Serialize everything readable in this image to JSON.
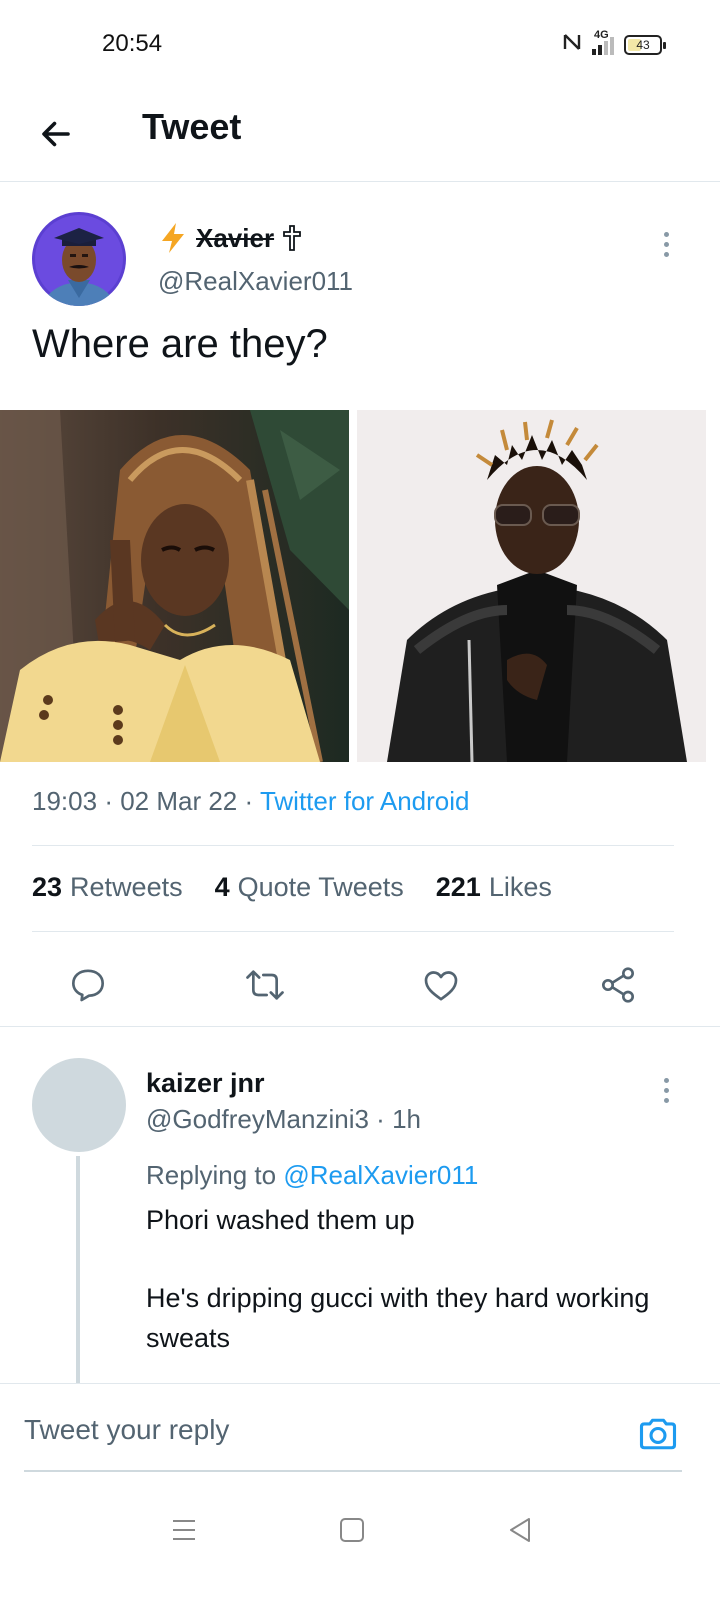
{
  "status_bar": {
    "time": "20:54",
    "network": "4G",
    "battery_level": "43",
    "battery_fraction": 0.43
  },
  "header": {
    "title": "Tweet",
    "back_icon": "arrow-left-icon"
  },
  "tweet": {
    "author_name": "Xavier",
    "author_handle": "@RealXavier011",
    "name_prefix_icon": "lightning-bolt-icon",
    "name_suffix_icon": "cross-icon",
    "text": "Where are they?",
    "time": "19:03",
    "date": "02 Mar 22",
    "source": "Twitter for Android",
    "stats": {
      "retweets_count": "23",
      "retweets_label": "Retweets",
      "quotes_count": "4",
      "quotes_label": "Quote Tweets",
      "likes_count": "221",
      "likes_label": "Likes"
    },
    "actions": [
      "reply-icon",
      "retweet-icon",
      "like-icon",
      "share-icon"
    ]
  },
  "reply": {
    "name": "kaizer jnr",
    "handle": "@GodfreyManzini3",
    "time": "1h",
    "replying_prefix": "Replying to",
    "replying_to": "@RealXavier011",
    "text_line1": "Phori washed them up",
    "text_line2": "He's dripping gucci with they hard working sweats"
  },
  "composer": {
    "placeholder": "Tweet your reply",
    "camera_icon": "camera-icon"
  },
  "nav": [
    "menu-icon",
    "home-square-icon",
    "back-triangle-icon"
  ],
  "colors": {
    "accent": "#1d9bf0",
    "text_primary": "#0f1419",
    "text_secondary": "#536471",
    "divider": "#e1e8ed"
  }
}
